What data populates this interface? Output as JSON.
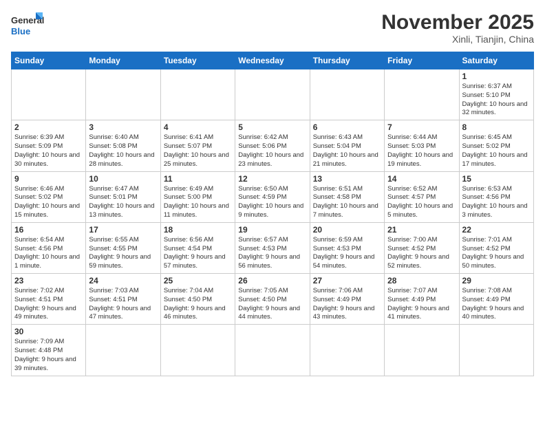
{
  "logo": {
    "text_general": "General",
    "text_blue": "Blue"
  },
  "title": "November 2025",
  "location": "Xinli, Tianjin, China",
  "weekdays": [
    "Sunday",
    "Monday",
    "Tuesday",
    "Wednesday",
    "Thursday",
    "Friday",
    "Saturday"
  ],
  "weeks": [
    [
      {
        "day": "",
        "info": ""
      },
      {
        "day": "",
        "info": ""
      },
      {
        "day": "",
        "info": ""
      },
      {
        "day": "",
        "info": ""
      },
      {
        "day": "",
        "info": ""
      },
      {
        "day": "",
        "info": ""
      },
      {
        "day": "1",
        "info": "Sunrise: 6:37 AM\nSunset: 5:10 PM\nDaylight: 10 hours\nand 32 minutes."
      }
    ],
    [
      {
        "day": "2",
        "info": "Sunrise: 6:39 AM\nSunset: 5:09 PM\nDaylight: 10 hours\nand 30 minutes."
      },
      {
        "day": "3",
        "info": "Sunrise: 6:40 AM\nSunset: 5:08 PM\nDaylight: 10 hours\nand 28 minutes."
      },
      {
        "day": "4",
        "info": "Sunrise: 6:41 AM\nSunset: 5:07 PM\nDaylight: 10 hours\nand 25 minutes."
      },
      {
        "day": "5",
        "info": "Sunrise: 6:42 AM\nSunset: 5:06 PM\nDaylight: 10 hours\nand 23 minutes."
      },
      {
        "day": "6",
        "info": "Sunrise: 6:43 AM\nSunset: 5:04 PM\nDaylight: 10 hours\nand 21 minutes."
      },
      {
        "day": "7",
        "info": "Sunrise: 6:44 AM\nSunset: 5:03 PM\nDaylight: 10 hours\nand 19 minutes."
      },
      {
        "day": "8",
        "info": "Sunrise: 6:45 AM\nSunset: 5:02 PM\nDaylight: 10 hours\nand 17 minutes."
      }
    ],
    [
      {
        "day": "9",
        "info": "Sunrise: 6:46 AM\nSunset: 5:02 PM\nDaylight: 10 hours\nand 15 minutes."
      },
      {
        "day": "10",
        "info": "Sunrise: 6:47 AM\nSunset: 5:01 PM\nDaylight: 10 hours\nand 13 minutes."
      },
      {
        "day": "11",
        "info": "Sunrise: 6:49 AM\nSunset: 5:00 PM\nDaylight: 10 hours\nand 11 minutes."
      },
      {
        "day": "12",
        "info": "Sunrise: 6:50 AM\nSunset: 4:59 PM\nDaylight: 10 hours\nand 9 minutes."
      },
      {
        "day": "13",
        "info": "Sunrise: 6:51 AM\nSunset: 4:58 PM\nDaylight: 10 hours\nand 7 minutes."
      },
      {
        "day": "14",
        "info": "Sunrise: 6:52 AM\nSunset: 4:57 PM\nDaylight: 10 hours\nand 5 minutes."
      },
      {
        "day": "15",
        "info": "Sunrise: 6:53 AM\nSunset: 4:56 PM\nDaylight: 10 hours\nand 3 minutes."
      }
    ],
    [
      {
        "day": "16",
        "info": "Sunrise: 6:54 AM\nSunset: 4:56 PM\nDaylight: 10 hours\nand 1 minute."
      },
      {
        "day": "17",
        "info": "Sunrise: 6:55 AM\nSunset: 4:55 PM\nDaylight: 9 hours\nand 59 minutes."
      },
      {
        "day": "18",
        "info": "Sunrise: 6:56 AM\nSunset: 4:54 PM\nDaylight: 9 hours\nand 57 minutes."
      },
      {
        "day": "19",
        "info": "Sunrise: 6:57 AM\nSunset: 4:53 PM\nDaylight: 9 hours\nand 56 minutes."
      },
      {
        "day": "20",
        "info": "Sunrise: 6:59 AM\nSunset: 4:53 PM\nDaylight: 9 hours\nand 54 minutes."
      },
      {
        "day": "21",
        "info": "Sunrise: 7:00 AM\nSunset: 4:52 PM\nDaylight: 9 hours\nand 52 minutes."
      },
      {
        "day": "22",
        "info": "Sunrise: 7:01 AM\nSunset: 4:52 PM\nDaylight: 9 hours\nand 50 minutes."
      }
    ],
    [
      {
        "day": "23",
        "info": "Sunrise: 7:02 AM\nSunset: 4:51 PM\nDaylight: 9 hours\nand 49 minutes."
      },
      {
        "day": "24",
        "info": "Sunrise: 7:03 AM\nSunset: 4:51 PM\nDaylight: 9 hours\nand 47 minutes."
      },
      {
        "day": "25",
        "info": "Sunrise: 7:04 AM\nSunset: 4:50 PM\nDaylight: 9 hours\nand 46 minutes."
      },
      {
        "day": "26",
        "info": "Sunrise: 7:05 AM\nSunset: 4:50 PM\nDaylight: 9 hours\nand 44 minutes."
      },
      {
        "day": "27",
        "info": "Sunrise: 7:06 AM\nSunset: 4:49 PM\nDaylight: 9 hours\nand 43 minutes."
      },
      {
        "day": "28",
        "info": "Sunrise: 7:07 AM\nSunset: 4:49 PM\nDaylight: 9 hours\nand 41 minutes."
      },
      {
        "day": "29",
        "info": "Sunrise: 7:08 AM\nSunset: 4:49 PM\nDaylight: 9 hours\nand 40 minutes."
      }
    ],
    [
      {
        "day": "30",
        "info": "Sunrise: 7:09 AM\nSunset: 4:48 PM\nDaylight: 9 hours\nand 39 minutes."
      },
      {
        "day": "",
        "info": ""
      },
      {
        "day": "",
        "info": ""
      },
      {
        "day": "",
        "info": ""
      },
      {
        "day": "",
        "info": ""
      },
      {
        "day": "",
        "info": ""
      },
      {
        "day": "",
        "info": ""
      }
    ]
  ]
}
